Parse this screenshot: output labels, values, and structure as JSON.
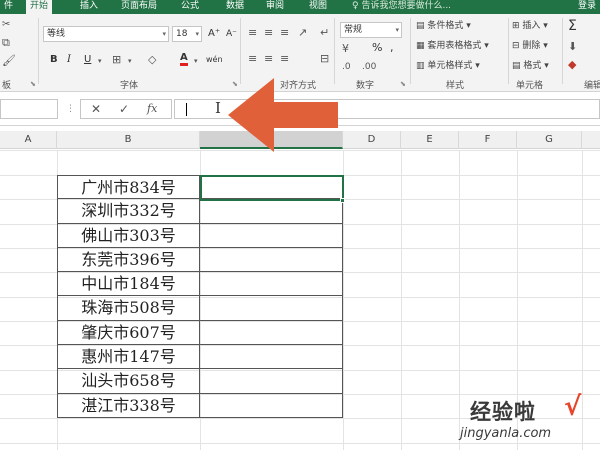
{
  "ribbon_tabs": [
    "件",
    "开始",
    "插入",
    "页面布局",
    "公式",
    "数据",
    "审阅",
    "视图"
  ],
  "active_tab_index": 1,
  "tell_me": "♀ 告诉我您想要做什么...",
  "login": "登录",
  "clipboard": {
    "label": "板",
    "paste_icon": "paste-icon",
    "cut_icon": "cut-icon",
    "copy_icon": "copy-icon"
  },
  "font": {
    "label": "字体",
    "family": "等线",
    "size": "18",
    "grow": "A⁺",
    "shrink": "A⁻",
    "bold": "B",
    "italic": "I",
    "underline": "U",
    "phonetic": "wén",
    "font_color_letter": "A",
    "font_color": "#e02020"
  },
  "alignment": {
    "label": "对齐方式"
  },
  "number": {
    "label": "数字",
    "format": "常规",
    "percent": "%",
    "comma": ","
  },
  "styles": {
    "label": "样式",
    "conditional": "条件格式",
    "table": "套用表格格式",
    "cell": "单元格样式"
  },
  "cells": {
    "label": "单元格",
    "insert": "插入",
    "delete": "删除",
    "format": "格式"
  },
  "editing": {
    "label": "编辑",
    "sum": "Σ"
  },
  "formula_bar": {
    "name_box": "",
    "cancel": "✕",
    "enter": "✓",
    "fx": "fx",
    "value": ""
  },
  "arrow_color": "#e0603a",
  "columns": [
    "A",
    "B",
    "C",
    "D",
    "E",
    "F",
    "G"
  ],
  "selected_column": "C",
  "table_rows": [
    "广州市834号",
    "深圳市332号",
    "佛山市303号",
    "东莞市396号",
    "中山市184号",
    "珠海市508号",
    "肇庆市607号",
    "惠州市147号",
    "汕头市658号",
    "湛江市338号"
  ],
  "watermark": {
    "cn": "经验啦",
    "check": "√",
    "url": "jingyanla.com"
  }
}
